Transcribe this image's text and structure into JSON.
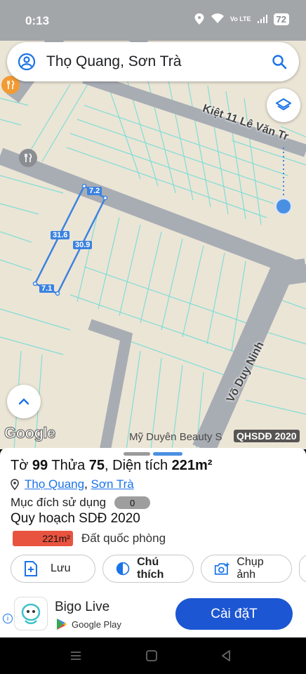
{
  "status_bar": {
    "time": "0:13",
    "battery": "72",
    "net_label": "Vo LTE"
  },
  "search": {
    "query": "Thọ Quang, Sơn Trà"
  },
  "map": {
    "streets": [
      "Kiệt 11 Lê Văn Tr",
      "Võ Duy Ninh"
    ],
    "dimensions": [
      "7.2",
      "31.6",
      "30.9",
      "7.1"
    ],
    "poi_label": "Mỹ Duyên Beauty S",
    "overlay_badge": "QHSDĐ 2020",
    "logo_text": "Google"
  },
  "parcel": {
    "to_label": "Tờ",
    "to_value": "99",
    "thua_label": "Thửa",
    "thua_value": "75",
    "area_label": "Diện tích",
    "area_value": "221m²",
    "ward": "Thọ Quang",
    "district": "Sơn Trà",
    "purpose_label": "Mục đích sử dụng",
    "purpose_value": "0",
    "plan_title": "Quy hoạch SDĐ 2020",
    "plan_area": "221m²",
    "plan_type": "Đất quốc phòng"
  },
  "actions": {
    "save": "Lưu",
    "legend": "Chú thích",
    "photo": "Chụp ảnh"
  },
  "ad": {
    "app_name": "Bigo Live",
    "store": "Google Play",
    "install": "Cài đặT"
  },
  "colors": {
    "accent": "#1a73e8",
    "install_button": "#1c56d3",
    "area_badge": "#e8533f",
    "parcel_line": "#3b82e0"
  }
}
